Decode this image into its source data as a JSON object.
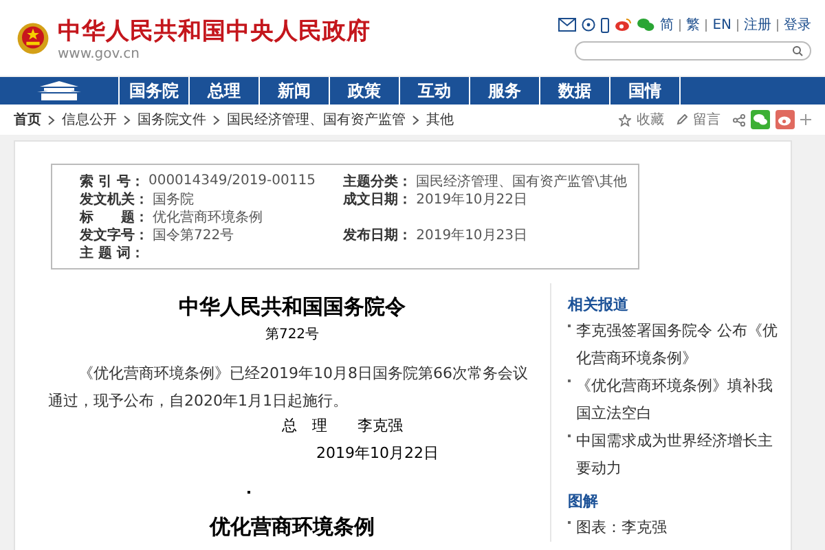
{
  "header": {
    "site_name": "中华人民共和国中央人民政府",
    "domain": "www.gov.cn",
    "lang_links": [
      "简",
      "繁",
      "EN",
      "注册",
      "登录"
    ]
  },
  "nav": [
    {
      "label": "国务院",
      "selected": false
    },
    {
      "label": "总理",
      "selected": false
    },
    {
      "label": "新闻",
      "selected": false
    },
    {
      "label": "政策",
      "selected": false
    },
    {
      "label": "互动",
      "selected": false
    },
    {
      "label": "服务",
      "selected": false
    },
    {
      "label": "数据",
      "selected": false
    },
    {
      "label": "国情",
      "selected": false
    }
  ],
  "breadcrumb": [
    "首页",
    "信息公开",
    "国务院文件",
    "国民经济管理、国有资产监管",
    "其他"
  ],
  "tools": [
    "收藏",
    "留言"
  ],
  "meta": {
    "left": [
      {
        "label": "索 引 号：",
        "value": "000014349/2019-00115"
      },
      {
        "label": "发文机关：",
        "value": "国务院"
      },
      {
        "label": "标　　题：",
        "value": "优化营商环境条例"
      },
      {
        "label": "发文字号：",
        "value": "国令第722号"
      },
      {
        "label": "主 题 词："
      }
    ],
    "right": [
      {
        "kind": "field",
        "label": "主题分类：",
        "value": "国民经济管理、国有资产监管\\其他"
      },
      {
        "kind": "field",
        "label": "成文日期：",
        "value": "2019年10月22日"
      },
      {
        "kind": "spacer"
      },
      {
        "kind": "field",
        "label": "发布日期：",
        "value": "2019年10月23日"
      }
    ]
  },
  "article": {
    "title": "中华人民共和国国务院令",
    "number": "第722号",
    "body": "《优化营商环境条例》已经2019年10月8日国务院第66次常务会议通过，现予公布，自2020年1月1日起施行。",
    "signer_title": "总　理",
    "signer": "李克强",
    "date": "2019年10月22日",
    "subtitle": "优化营商环境条例"
  },
  "sidebar": [
    {
      "heading": "相关报道",
      "items": [
        "李克强签署国务院令 公布《优化营商环境条例》",
        "《优化营商环境条例》填补我国立法空白",
        "中国需求成为世界经济增长主要动力"
      ]
    },
    {
      "heading": "图解",
      "items": [
        "图表：李克强"
      ]
    }
  ]
}
